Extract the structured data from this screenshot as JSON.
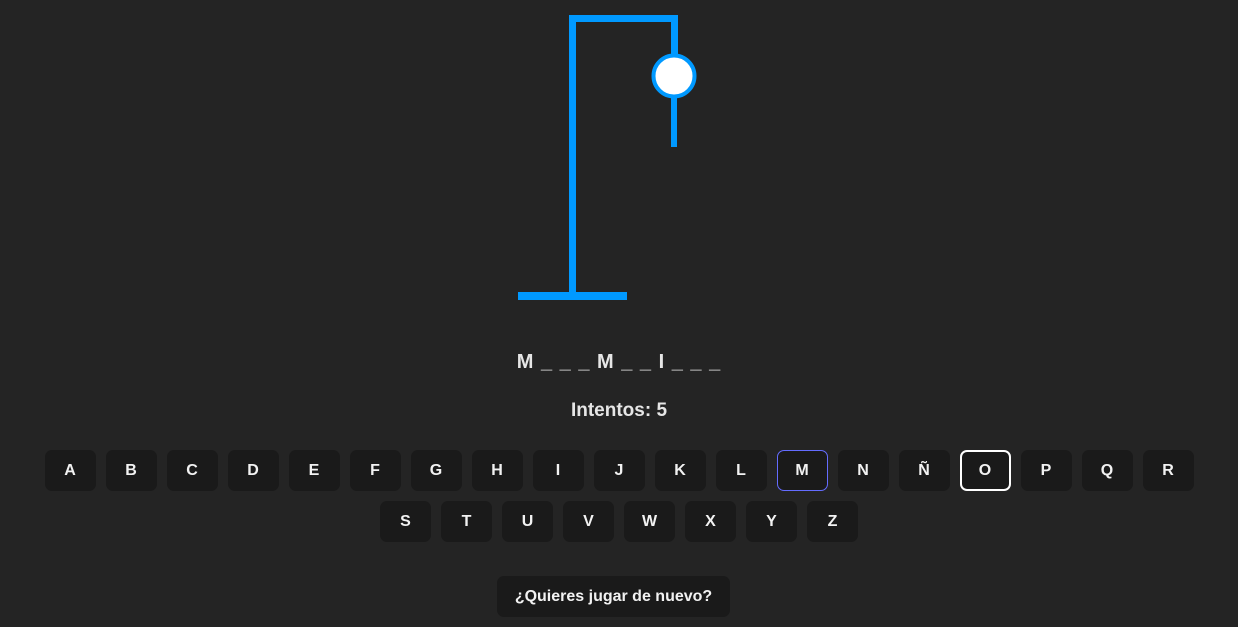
{
  "game": {
    "word_display": "M _ _ _ M _ _ I _ _ _",
    "attempts_label": "Intentos: 5",
    "accent_color": "#0099ff",
    "parts_shown": [
      "base",
      "pole",
      "beam",
      "rope",
      "head"
    ]
  },
  "keyboard": {
    "rows": [
      [
        {
          "letter": "A",
          "state": "unused"
        },
        {
          "letter": "B",
          "state": "unused"
        },
        {
          "letter": "C",
          "state": "unused"
        },
        {
          "letter": "D",
          "state": "unused"
        },
        {
          "letter": "E",
          "state": "unused"
        },
        {
          "letter": "F",
          "state": "unused"
        },
        {
          "letter": "G",
          "state": "unused"
        },
        {
          "letter": "H",
          "state": "unused"
        },
        {
          "letter": "I",
          "state": "unused"
        },
        {
          "letter": "J",
          "state": "unused"
        },
        {
          "letter": "K",
          "state": "unused"
        },
        {
          "letter": "L",
          "state": "unused"
        },
        {
          "letter": "M",
          "state": "correct"
        },
        {
          "letter": "N",
          "state": "unused"
        },
        {
          "letter": "Ñ",
          "state": "unused"
        },
        {
          "letter": "O",
          "state": "wrong"
        },
        {
          "letter": "P",
          "state": "unused"
        },
        {
          "letter": "Q",
          "state": "unused"
        },
        {
          "letter": "R",
          "state": "unused"
        }
      ],
      [
        {
          "letter": "S",
          "state": "unused"
        },
        {
          "letter": "T",
          "state": "unused"
        },
        {
          "letter": "U",
          "state": "unused"
        },
        {
          "letter": "V",
          "state": "unused"
        },
        {
          "letter": "W",
          "state": "unused"
        },
        {
          "letter": "X",
          "state": "unused"
        },
        {
          "letter": "Y",
          "state": "unused"
        },
        {
          "letter": "Z",
          "state": "unused"
        }
      ]
    ]
  },
  "actions": {
    "replay_label": "¿Quieres jugar de nuevo?"
  }
}
